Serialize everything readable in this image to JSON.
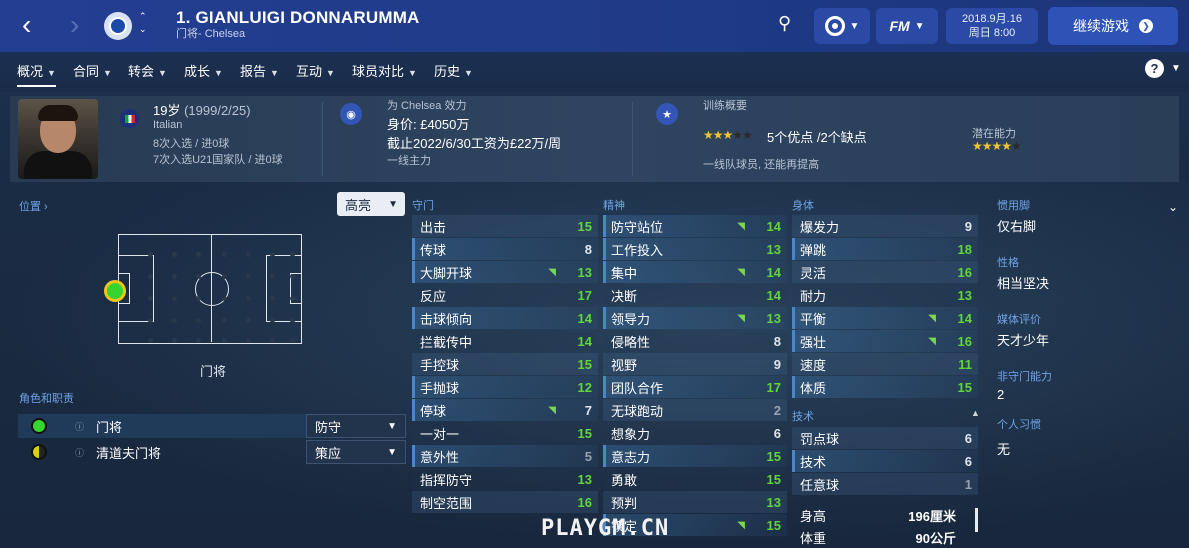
{
  "header": {
    "title": "1. GIANLUIGI DONNARUMMA",
    "subtitle": "门将- Chelsea",
    "date": "2018.9月.16",
    "day_time": "周日 8:00",
    "continue": "继续游戏",
    "fm": "FM"
  },
  "menu": [
    "概况",
    "合同",
    "转会",
    "成长",
    "报告",
    "互动",
    "球员对比",
    "历史"
  ],
  "info": {
    "age": "19岁",
    "dob": "(1999/2/25)",
    "nationality": "Italian",
    "caps": "8次入选 / 进0球",
    "u21": "7次入选U21国家队 / 进0球",
    "plays_for": "为 Chelsea 效力",
    "value": "身价: £4050万",
    "contract": "截止2022/6/30工资为£22万/周",
    "squad_status": "一线主力",
    "training_title": "训练概要",
    "strengths": "5个优点 /2个缺点",
    "potential_label": "潜在能力",
    "training_note": "一线队球员, 还能再提高",
    "current_stars": 3,
    "potential_stars": 4
  },
  "position": {
    "heading": "位置",
    "highlight": "高亮",
    "position_label": "门将"
  },
  "roles": {
    "heading": "角色和职责",
    "rows": [
      {
        "role": "门将",
        "duty": "防守",
        "color": "#36d42f"
      },
      {
        "role": "清道夫门将",
        "duty": "策应",
        "color": "#d6d01c"
      }
    ]
  },
  "columns": {
    "goalkeeping": {
      "title": "守门",
      "attrs": [
        {
          "name": "出击",
          "value": "15",
          "color": "#61d63a",
          "up": false
        },
        {
          "name": "传球",
          "value": "8",
          "color": "#e0e6ee",
          "up": false
        },
        {
          "name": "大脚开球",
          "value": "13",
          "color": "#61d63a",
          "up": true
        },
        {
          "name": "反应",
          "value": "17",
          "color": "#61d63a",
          "up": false
        },
        {
          "name": "击球倾向",
          "value": "14",
          "color": "#61d63a",
          "up": false
        },
        {
          "name": "拦截传中",
          "value": "14",
          "color": "#61d63a",
          "up": false
        },
        {
          "name": "手控球",
          "value": "15",
          "color": "#61d63a",
          "up": false
        },
        {
          "name": "手抛球",
          "value": "12",
          "color": "#61d63a",
          "up": false
        },
        {
          "name": "停球",
          "value": "7",
          "color": "#e0e6ee",
          "up": true
        },
        {
          "name": "一对一",
          "value": "15",
          "color": "#61d63a",
          "up": false
        },
        {
          "name": "意外性",
          "value": "5",
          "color": "#9aa3ad",
          "up": false
        },
        {
          "name": "指挥防守",
          "value": "13",
          "color": "#61d63a",
          "up": false
        },
        {
          "name": "制空范围",
          "value": "16",
          "color": "#61d63a",
          "up": false
        }
      ]
    },
    "mental": {
      "title": "精神",
      "attrs": [
        {
          "name": "防守站位",
          "value": "14",
          "color": "#61d63a",
          "up": true
        },
        {
          "name": "工作投入",
          "value": "13",
          "color": "#61d63a",
          "up": false
        },
        {
          "name": "集中",
          "value": "14",
          "color": "#61d63a",
          "up": true
        },
        {
          "name": "决断",
          "value": "14",
          "color": "#61d63a",
          "up": false
        },
        {
          "name": "领导力",
          "value": "13",
          "color": "#61d63a",
          "up": true
        },
        {
          "name": "侵略性",
          "value": "8",
          "color": "#e0e6ee",
          "up": false
        },
        {
          "name": "视野",
          "value": "9",
          "color": "#e0e6ee",
          "up": false
        },
        {
          "name": "团队合作",
          "value": "17",
          "color": "#61d63a",
          "up": false
        },
        {
          "name": "无球跑动",
          "value": "2",
          "color": "#9aa3ad",
          "up": false
        },
        {
          "name": "想象力",
          "value": "6",
          "color": "#e0e6ee",
          "up": false
        },
        {
          "name": "意志力",
          "value": "15",
          "color": "#61d63a",
          "up": false
        },
        {
          "name": "勇敢",
          "value": "15",
          "color": "#61d63a",
          "up": false
        },
        {
          "name": "预判",
          "value": "13",
          "color": "#61d63a",
          "up": false
        },
        {
          "name": "镇定",
          "value": "15",
          "color": "#61d63a",
          "up": true
        }
      ]
    },
    "physical": {
      "title": "身体",
      "attrs": [
        {
          "name": "爆发力",
          "value": "9",
          "color": "#e0e6ee",
          "up": false
        },
        {
          "name": "弹跳",
          "value": "18",
          "color": "#61d63a",
          "up": false
        },
        {
          "name": "灵活",
          "value": "16",
          "color": "#61d63a",
          "up": false
        },
        {
          "name": "耐力",
          "value": "13",
          "color": "#61d63a",
          "up": false
        },
        {
          "name": "平衡",
          "value": "14",
          "color": "#61d63a",
          "up": true
        },
        {
          "name": "强壮",
          "value": "16",
          "color": "#61d63a",
          "up": true
        },
        {
          "name": "速度",
          "value": "11",
          "color": "#61d63a",
          "up": false
        },
        {
          "name": "体质",
          "value": "15",
          "color": "#61d63a",
          "up": false
        }
      ]
    },
    "technical": {
      "title": "技术",
      "attrs": [
        {
          "name": "罚点球",
          "value": "6",
          "color": "#e0e6ee",
          "up": false
        },
        {
          "name": "技术",
          "value": "6",
          "color": "#e0e6ee",
          "up": false
        },
        {
          "name": "任意球",
          "value": "1",
          "color": "#9aa3ad",
          "up": false
        }
      ]
    },
    "body": [
      {
        "name": "身高",
        "value": "196厘米"
      },
      {
        "name": "体重",
        "value": "90公斤"
      }
    ]
  },
  "right": [
    {
      "heading": "惯用脚",
      "value": "仅右脚"
    },
    {
      "heading": "性格",
      "value": "相当坚决"
    },
    {
      "heading": "媒体评价",
      "value": "天才少年"
    },
    {
      "heading": "非守门能力",
      "value": "2"
    },
    {
      "heading": "个人习惯",
      "value": "无"
    }
  ],
  "watermark": "PLAYGM.CN"
}
